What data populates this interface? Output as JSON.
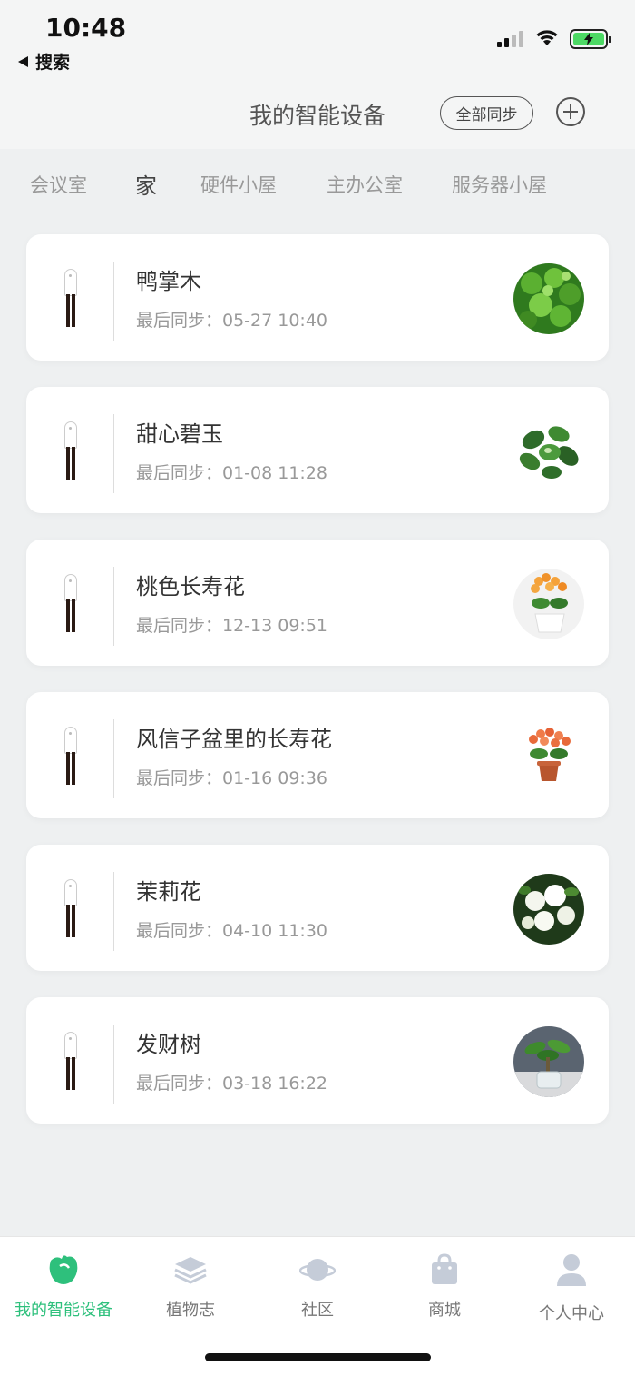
{
  "status_bar": {
    "time": "10:48",
    "back_label": "搜索",
    "icons": [
      "signal-icon",
      "wifi-icon",
      "battery-charging-icon"
    ],
    "battery_color": "#4cd964"
  },
  "header": {
    "title": "我的智能设备",
    "sync_all_label": "全部同步",
    "add_icon": "plus-circle-icon"
  },
  "tabs": [
    "会议室",
    "家",
    "硬件小屋",
    "主办公室",
    "服务器小屋"
  ],
  "active_tab": "家",
  "devices": [
    {
      "name": "鸭掌木",
      "sync": "最后同步：05-27 10:40"
    },
    {
      "name": "甜心碧玉",
      "sync": "最后同步：01-08 11:28"
    },
    {
      "name": "桃色长寿花",
      "sync": "最后同步：12-13 09:51"
    },
    {
      "name": "风信子盆里的长寿花",
      "sync": "最后同步：01-16 09:36"
    },
    {
      "name": "茉莉花",
      "sync": "最后同步：04-10 11:30"
    },
    {
      "name": "发财树",
      "sync": "最后同步：03-18 16:22"
    }
  ],
  "bottom_nav": [
    {
      "label": "我的智能设备",
      "icon": "plant-bulb-icon",
      "active": true
    },
    {
      "label": "植物志",
      "icon": "layers-icon",
      "active": false
    },
    {
      "label": "社区",
      "icon": "planet-icon",
      "active": false
    },
    {
      "label": "商城",
      "icon": "shopping-bag-icon",
      "active": false
    },
    {
      "label": "个人中心",
      "icon": "person-icon",
      "active": false
    }
  ],
  "colors": {
    "accent": "#2ec07c",
    "inactive_icon": "#c5ccd8",
    "background": "#eef0f1"
  }
}
